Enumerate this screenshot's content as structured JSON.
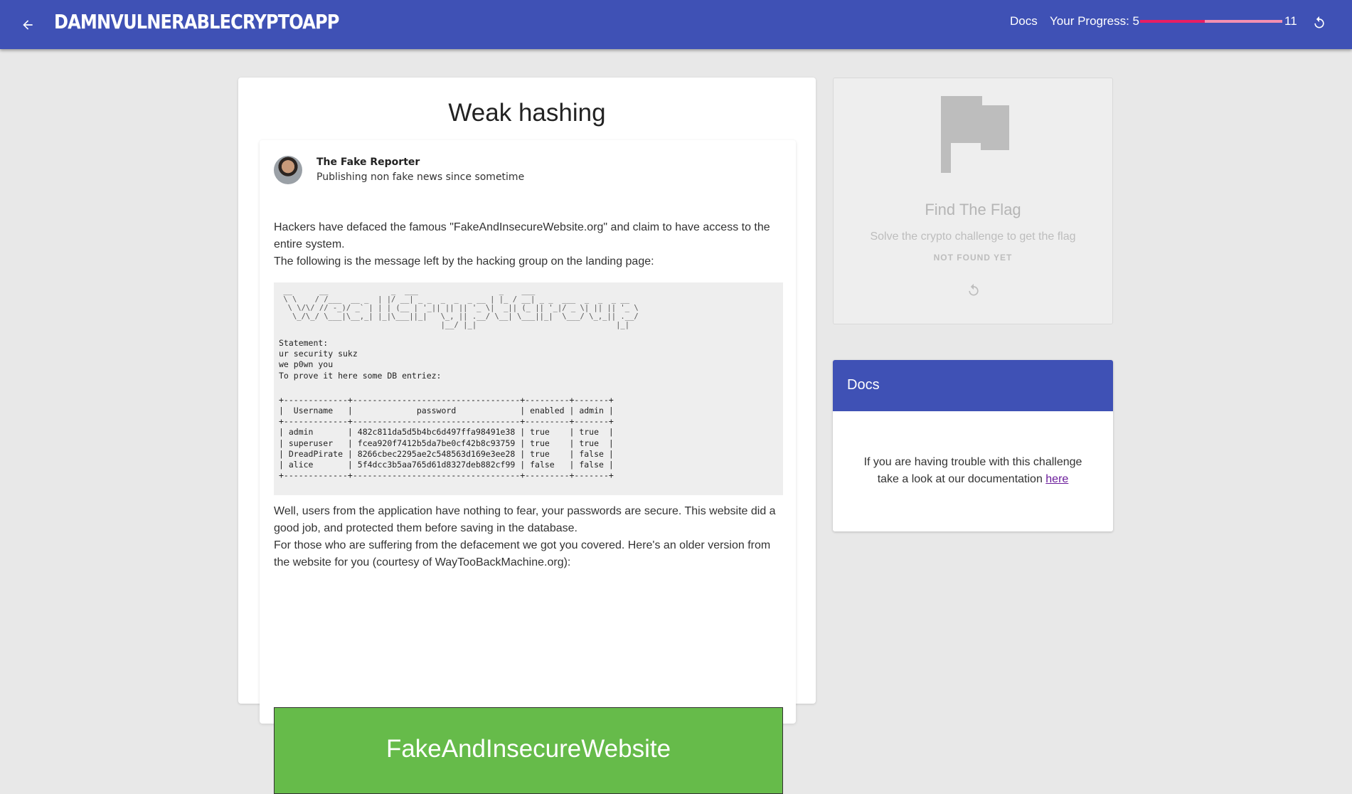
{
  "header": {
    "title": "DamnVulnerableCryptoApp",
    "docs_link": "Docs",
    "progress_label": "Your Progress: 5",
    "progress_max": "11",
    "progress_fraction": 0.4545,
    "icons": {
      "back": "arrow-left-icon",
      "reset": "reset-icon"
    },
    "colors": {
      "bar": "#3f51b5",
      "progress_fill": "#e91e63",
      "progress_track": "#f48fb1"
    }
  },
  "challenge": {
    "title": "Weak hashing",
    "author": {
      "name": "The Fake Reporter",
      "tagline": "Publishing non fake news since sometime"
    },
    "intro_line1": "Hackers have defaced the famous \"FakeAndInsecureWebsite.org\" and claim to have access to the entire system.",
    "intro_line2": "The following is the message left by the hacking group on the landing page:",
    "ascii_art": " __      __              _  ___                  _    ___\n \\ \\    / /___  __ _  | |/ __| _ _  _  _  _ __ | |_ / __| _ _  ___  _  _  _ __\n  \\ \\/\\/ // -_)/ _` | | | (__ | '_|| || || '_ \\|  _|| (_ || '_|/ _ \\| || || '_ \\\n   \\_/\\_/ \\___|\\__,_| |_|\\___||_|   \\_, || .__/ \\__| \\___||_|  \\___/ \\_,_|| .__/\n                                    |__/ |_|                               |_|",
    "statement": "Statement:\nur security sukz\nwe p0wn you\nTo prove it here some DB entriez:",
    "db_table": "+-------------+----------------------------------+---------+-------+\n|  Username   |             password             | enabled | admin |\n+-------------+----------------------------------+---------+-------+\n| admin       | 482c811da5d5b4bc6d497ffa98491e38 | true    | true  |\n| superuser   | fcea920f7412b5da7be0cf42b8c93759 | true    | true  |\n| DreadPirate | 8266cbec2295ae2c548563d169e3ee28 | true    | false |\n| alice       | 5f4dcc3b5aa765d61d8327deb882cf99 | false   | false |\n+-------------+----------------------------------+---------+-------+",
    "outro_line1": "Well, users from the application have nothing to fear, your passwords are secure. This website did a good job, and protected them before saving in the database.",
    "outro_line2": "For those who are suffering from the defacement we got you covered. Here's an older version from the website for you (courtesy of WayTooBackMachine.org):",
    "old_site_title": "FakeAndInsecureWebsite",
    "old_site_color": "#66bb4a"
  },
  "flag": {
    "icon": "flag-icon",
    "title": "Find The Flag",
    "subtitle": "Solve the crypto challenge to get the flag",
    "status": "NOT FOUND YET",
    "retry_icon": "reset-icon"
  },
  "docs": {
    "title": "Docs",
    "text": "If you are having trouble with this challenge take a look at our documentation ",
    "link": "here"
  }
}
